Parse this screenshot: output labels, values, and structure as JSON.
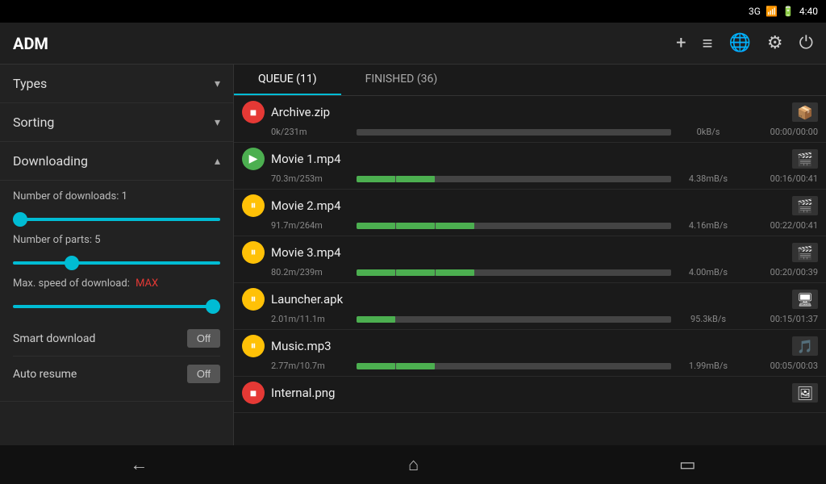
{
  "statusBar": {
    "network": "3G",
    "signal": "▐▌",
    "battery": "🔋",
    "time": "4:40"
  },
  "toolbar": {
    "title": "ADM",
    "icons": {
      "add": "+",
      "menu": "≡",
      "globe": "🌐",
      "settings": "⚙",
      "power": "⏻"
    }
  },
  "sidebar": {
    "types_label": "Types",
    "sorting_label": "Sorting",
    "downloading_label": "Downloading",
    "num_downloads_label": "Number of downloads: 1",
    "num_parts_label": "Number of parts: 5",
    "max_speed_label": "Max. speed of download:",
    "max_speed_value": "MAX",
    "smart_download_label": "Smart download",
    "smart_download_value": "Off",
    "auto_resume_label": "Auto resume",
    "auto_resume_value": "Off"
  },
  "tabs": [
    {
      "label": "QUEUE (11)",
      "active": true
    },
    {
      "label": "FINISHED (36)",
      "active": false
    }
  ],
  "downloads": [
    {
      "name": "Archive.zip",
      "status": "stopped",
      "icon_type": "red",
      "thumb_icon": "📦",
      "progress_text": "0k/231m",
      "speed": "0kB/s",
      "time": "00:00/00:00",
      "progress_pct": 0
    },
    {
      "name": "Movie 1.mp4",
      "status": "playing",
      "icon_type": "green",
      "thumb_icon": "🎬",
      "progress_text": "70.3m/253m",
      "speed": "4.38mB/s",
      "time": "00:16/00:41",
      "progress_pct": 28
    },
    {
      "name": "Movie 2.mp4",
      "status": "paused",
      "icon_type": "yellow",
      "thumb_icon": "🎬",
      "progress_text": "91.7m/264m",
      "speed": "4.16mB/s",
      "time": "00:22/00:41",
      "progress_pct": 35
    },
    {
      "name": "Movie 3.mp4",
      "status": "paused",
      "icon_type": "yellow",
      "thumb_icon": "🎬",
      "progress_text": "80.2m/239m",
      "speed": "4.00mB/s",
      "time": "00:20/00:39",
      "progress_pct": 34
    },
    {
      "name": "Launcher.apk",
      "status": "paused",
      "icon_type": "yellow",
      "thumb_icon": "🖥",
      "progress_text": "2.01m/11.1m",
      "speed": "95.3kB/s",
      "time": "00:15/01:37",
      "progress_pct": 18
    },
    {
      "name": "Music.mp3",
      "status": "paused",
      "icon_type": "yellow",
      "thumb_icon": "🎵",
      "progress_text": "2.77m/10.7m",
      "speed": "1.99mB/s",
      "time": "00:05/00:03",
      "progress_pct": 26
    },
    {
      "name": "Internal.png",
      "status": "stopped",
      "icon_type": "red",
      "thumb_icon": "🖼",
      "progress_text": "",
      "speed": "",
      "time": "",
      "progress_pct": 0
    }
  ],
  "bottomNav": {
    "back": "←",
    "home": "⌂",
    "recent": "▭"
  }
}
